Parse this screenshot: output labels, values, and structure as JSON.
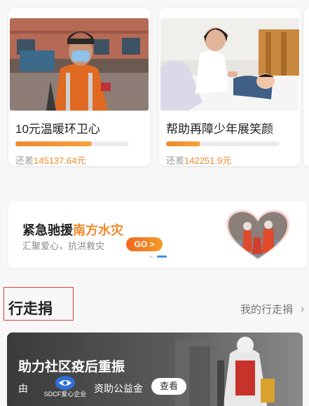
{
  "cards": [
    {
      "title": "10元温暖环卫心",
      "remaining_prefix": "还差",
      "remaining_amount": "145137.64",
      "remaining_unit": "元",
      "progress": 0.67
    },
    {
      "title": "帮助再障少年展笑颜",
      "remaining_prefix": "还差",
      "remaining_amount": "142251.9",
      "remaining_unit": "元",
      "progress": 0.3
    }
  ],
  "banner": {
    "title_prefix": "紧急驰援",
    "title_highlight": "南方水灾",
    "subtitle": "汇聚爱心，抗洪救灾",
    "go_label": "GO >",
    "carousel_active_index": 1,
    "carousel_count": 2
  },
  "section": {
    "title": "行走捐",
    "link_label": "我的行走捐",
    "link_icon": "chevron-right-icon"
  },
  "walk_card": {
    "title": "助力社区疫后重振",
    "by_label": "由",
    "sponsor_logo_text": "SDCF爱心企业",
    "fund_label": "资助公益金",
    "view_label": "查看"
  },
  "colors": {
    "accent": "#f08a2a",
    "highlight_box": "#e03b3b"
  }
}
